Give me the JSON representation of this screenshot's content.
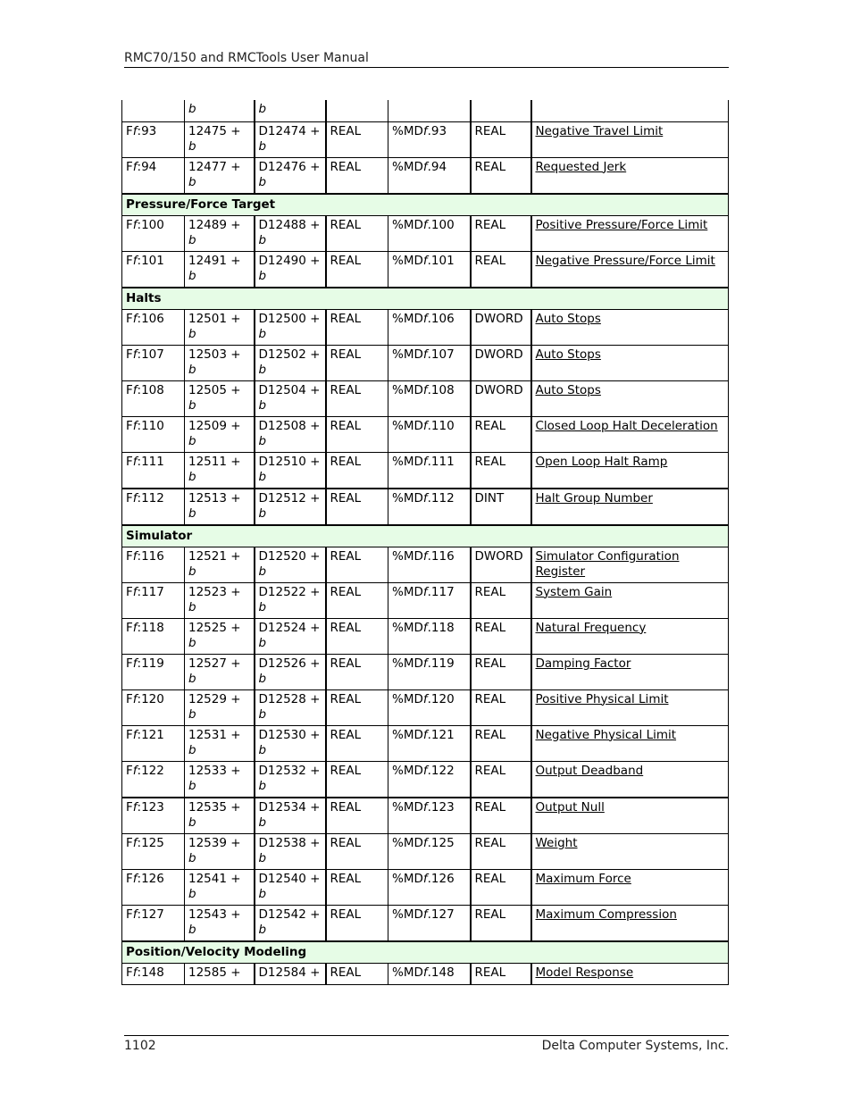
{
  "header": {
    "title": "RMC70/150 and RMCTools User Manual"
  },
  "footer": {
    "page_number": "1102",
    "company": "Delta Computer Systems, Inc."
  },
  "table": {
    "continued_row": {
      "col2_suffix": "b",
      "col3_suffix": "b"
    },
    "groups": [
      {
        "section": null,
        "rows": [
          {
            "ff": "Ff",
            "ff_num": ":93",
            "addr": "12475 +",
            "addr_b": "b",
            "dreg": "D12474 +",
            "dreg_b": "b",
            "type": "REAL",
            "md_prefix": "%MD",
            "md_f": "f",
            "md_num": ".93",
            "dtype": "REAL",
            "name": "Negative Travel Limit"
          },
          {
            "ff": "Ff",
            "ff_num": ":94",
            "addr": "12477 +",
            "addr_b": "b",
            "dreg": "D12476 +",
            "dreg_b": "b",
            "type": "REAL",
            "md_prefix": "%MD",
            "md_f": "f",
            "md_num": ".94",
            "dtype": "REAL",
            "name": "Requested Jerk"
          }
        ]
      },
      {
        "section": "Pressure/Force Target",
        "rows": [
          {
            "ff": "Ff",
            "ff_num": ":100",
            "addr": "12489 +",
            "addr_b": "b",
            "dreg": "D12488 +",
            "dreg_b": "b",
            "type": "REAL",
            "md_prefix": "%MD",
            "md_f": "f",
            "md_num": ".100",
            "dtype": "REAL",
            "name": "Positive Pressure/Force Limit"
          },
          {
            "ff": "Ff",
            "ff_num": ":101",
            "addr": "12491 +",
            "addr_b": "b",
            "dreg": "D12490 +",
            "dreg_b": "b",
            "type": "REAL",
            "md_prefix": "%MD",
            "md_f": "f",
            "md_num": ".101",
            "dtype": "REAL",
            "name": "Negative Pressure/Force Limit"
          }
        ]
      },
      {
        "section": "Halts",
        "rows": [
          {
            "ff": "Ff",
            "ff_num": ":106",
            "addr": "12501 +",
            "addr_b": "b",
            "dreg": "D12500 +",
            "dreg_b": "b",
            "type": "REAL",
            "md_prefix": "%MD",
            "md_f": "f",
            "md_num": ".106",
            "dtype": "DWORD",
            "name": "Auto Stops"
          },
          {
            "ff": "Ff",
            "ff_num": ":107",
            "addr": "12503 +",
            "addr_b": "b",
            "dreg": "D12502 +",
            "dreg_b": "b",
            "type": "REAL",
            "md_prefix": "%MD",
            "md_f": "f",
            "md_num": ".107",
            "dtype": "DWORD",
            "name": "Auto Stops"
          },
          {
            "ff": "Ff",
            "ff_num": ":108",
            "addr": "12505 +",
            "addr_b": "b",
            "dreg": "D12504 +",
            "dreg_b": "b",
            "type": "REAL",
            "md_prefix": "%MD",
            "md_f": "f",
            "md_num": ".108",
            "dtype": "DWORD",
            "name": "Auto Stops"
          },
          {
            "ff": "Ff",
            "ff_num": ":110",
            "addr": "12509 +",
            "addr_b": "b",
            "dreg": "D12508 +",
            "dreg_b": "b",
            "type": "REAL",
            "md_prefix": "%MD",
            "md_f": "f",
            "md_num": ".110",
            "dtype": "REAL",
            "name": "Closed Loop Halt Deceleration"
          },
          {
            "ff": "Ff",
            "ff_num": ":111",
            "addr": "12511 +",
            "addr_b": "b",
            "dreg": "D12510 +",
            "dreg_b": "b",
            "type": "REAL",
            "md_prefix": "%MD",
            "md_f": "f",
            "md_num": ".111",
            "dtype": "REAL",
            "name": "Open Loop Halt Ramp"
          },
          {
            "ff": "Ff",
            "ff_num": ":112",
            "addr": "12513 +",
            "addr_b": "b",
            "dreg": "D12512 +",
            "dreg_b": "b",
            "type": "REAL",
            "md_prefix": "%MD",
            "md_f": "f",
            "md_num": ".112",
            "dtype": "DINT",
            "name": "Halt Group Number"
          }
        ]
      },
      {
        "section": "Simulator",
        "rows": [
          {
            "ff": "Ff",
            "ff_num": ":116",
            "addr": "12521 +",
            "addr_b": "b",
            "dreg": "D12520 +",
            "dreg_b": "b",
            "type": "REAL",
            "md_prefix": "%MD",
            "md_f": "f",
            "md_num": ".116",
            "dtype": "DWORD",
            "name": "Simulator Configuration Register"
          },
          {
            "ff": "Ff",
            "ff_num": ":117",
            "addr": "12523 +",
            "addr_b": "b",
            "dreg": "D12522 +",
            "dreg_b": "b",
            "type": "REAL",
            "md_prefix": "%MD",
            "md_f": "f",
            "md_num": ".117",
            "dtype": "REAL",
            "name": "System Gain"
          },
          {
            "ff": "Ff",
            "ff_num": ":118",
            "addr": "12525 +",
            "addr_b": "b",
            "dreg": "D12524 +",
            "dreg_b": "b",
            "type": "REAL",
            "md_prefix": "%MD",
            "md_f": "f",
            "md_num": ".118",
            "dtype": "REAL",
            "name": "Natural Frequency"
          },
          {
            "ff": "Ff",
            "ff_num": ":119",
            "addr": "12527 +",
            "addr_b": "b",
            "dreg": "D12526 +",
            "dreg_b": "b",
            "type": "REAL",
            "md_prefix": "%MD",
            "md_f": "f",
            "md_num": ".119",
            "dtype": "REAL",
            "name": "Damping Factor"
          },
          {
            "ff": "Ff",
            "ff_num": ":120",
            "addr": "12529 +",
            "addr_b": "b",
            "dreg": "D12528 +",
            "dreg_b": "b",
            "type": "REAL",
            "md_prefix": "%MD",
            "md_f": "f",
            "md_num": ".120",
            "dtype": "REAL",
            "name": "Positive Physical Limit"
          },
          {
            "ff": "Ff",
            "ff_num": ":121",
            "addr": "12531 +",
            "addr_b": "b",
            "dreg": "D12530 +",
            "dreg_b": "b",
            "type": "REAL",
            "md_prefix": "%MD",
            "md_f": "f",
            "md_num": ".121",
            "dtype": "REAL",
            "name": "Negative Physical Limit"
          },
          {
            "ff": "Ff",
            "ff_num": ":122",
            "addr": "12533 +",
            "addr_b": "b",
            "dreg": "D12532 +",
            "dreg_b": "b",
            "type": "REAL",
            "md_prefix": "%MD",
            "md_f": "f",
            "md_num": ".122",
            "dtype": "REAL",
            "name": "Output Deadband"
          },
          {
            "ff": "Ff",
            "ff_num": ":123",
            "addr": "12535 +",
            "addr_b": "b",
            "dreg": "D12534 +",
            "dreg_b": "b",
            "type": "REAL",
            "md_prefix": "%MD",
            "md_f": "f",
            "md_num": ".123",
            "dtype": "REAL",
            "name": "Output Null"
          },
          {
            "ff": "Ff",
            "ff_num": ":125",
            "addr": "12539 +",
            "addr_b": "b",
            "dreg": "D12538 +",
            "dreg_b": "b",
            "type": "REAL",
            "md_prefix": "%MD",
            "md_f": "f",
            "md_num": ".125",
            "dtype": "REAL",
            "name": "Weight"
          },
          {
            "ff": "Ff",
            "ff_num": ":126",
            "addr": "12541 +",
            "addr_b": "b",
            "dreg": "D12540 +",
            "dreg_b": "b",
            "type": "REAL",
            "md_prefix": "%MD",
            "md_f": "f",
            "md_num": ".126",
            "dtype": "REAL",
            "name": "Maximum Force"
          },
          {
            "ff": "Ff",
            "ff_num": ":127",
            "addr": "12543 +",
            "addr_b": "b",
            "dreg": "D12542 +",
            "dreg_b": "b",
            "type": "REAL",
            "md_prefix": "%MD",
            "md_f": "f",
            "md_num": ".127",
            "dtype": "REAL",
            "name": "Maximum Compression"
          }
        ]
      },
      {
        "section": "Position/Velocity Modeling",
        "rows": [
          {
            "ff": "Ff",
            "ff_num": ":148",
            "addr": "12585 +",
            "addr_b": "",
            "dreg": "D12584 +",
            "dreg_b": "",
            "type": "REAL",
            "md_prefix": "%MD",
            "md_f": "f",
            "md_num": ".148",
            "dtype": "REAL",
            "name": "Model Response"
          }
        ]
      }
    ]
  }
}
